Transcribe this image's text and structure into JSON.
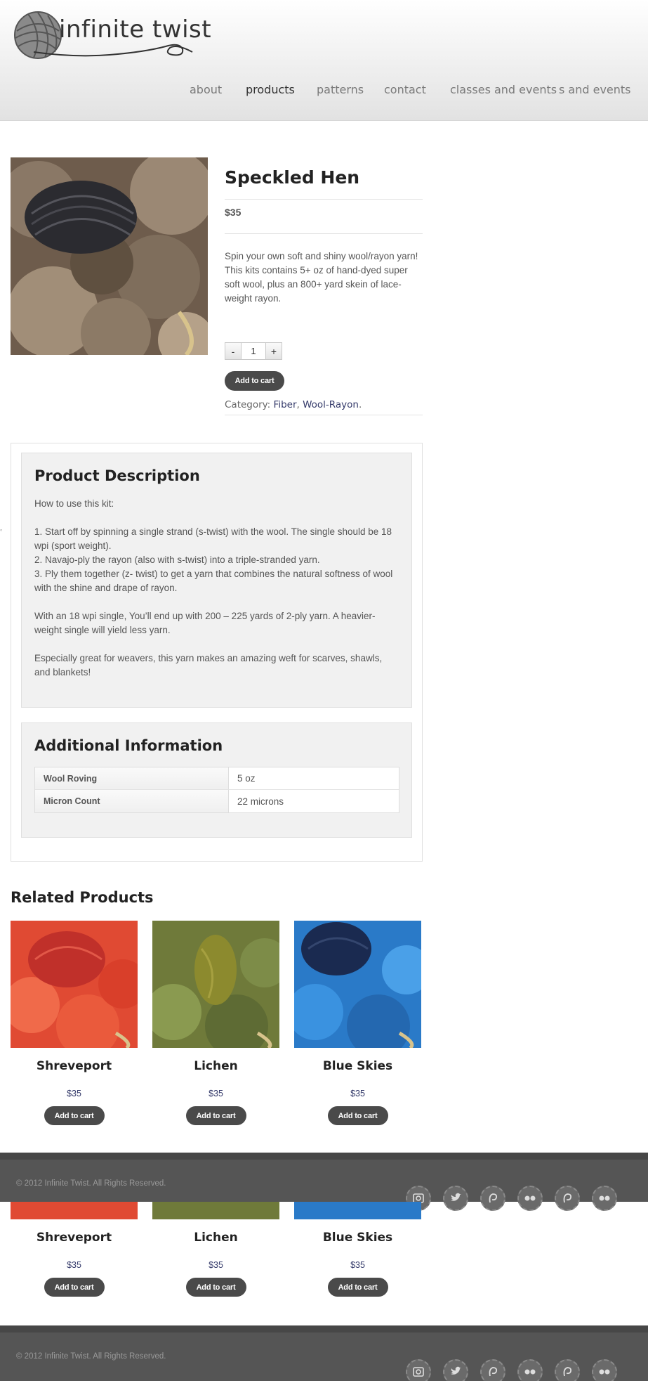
{
  "brand": {
    "logo_text": "infinite twist"
  },
  "nav": {
    "items": [
      {
        "label": "about",
        "active": false
      },
      {
        "label": "products",
        "active": true
      },
      {
        "label": "patterns",
        "active": false
      },
      {
        "label": "contact",
        "active": false
      },
      {
        "label": "classes and events",
        "active": false
      }
    ],
    "overflow_label": "s and events"
  },
  "product": {
    "title": "Speckled Hen",
    "price": "$35",
    "description": "Spin your own soft and shiny wool/rayon yarn! This kits contains 5+ oz of hand-dyed super soft wool, plus an 800+ yard skein of lace-weight rayon.",
    "qty_minus": "-",
    "qty_value": "1",
    "qty_plus": "+",
    "add_to_cart": "Add to cart",
    "category_label": "Category:",
    "categories": [
      "Fiber",
      "Wool-Rayon"
    ],
    "category_sep": ",",
    "category_end": "."
  },
  "tabs": {
    "description": {
      "heading": "Product Description",
      "intro": "How to use this kit:",
      "steps": [
        "1. Start off by spinning a single strand (s-twist) with the wool. The single should be 18 wpi (sport weight).",
        "2. Navajo-ply the rayon (also with s-twist) into a triple-stranded yarn.",
        "3. Ply them together (z- twist) to get a yarn that combines the natural softness of wool with the shine and drape of rayon."
      ],
      "para2": "With an 18 wpi single, You’ll end up with 200 – 225 yards of 2-ply yarn. A heavier-weight single will yield less yarn.",
      "para3": "Especially great for weavers, this yarn makes an amazing weft for scarves, shawls, and blankets!"
    },
    "additional": {
      "heading": "Additional Information",
      "rows": [
        {
          "key": "Wool Roving",
          "value": "5 oz"
        },
        {
          "key": "Micron Count",
          "value": "22 microns"
        }
      ]
    }
  },
  "related": {
    "heading": "Related Products",
    "items": [
      {
        "name": "Shreveport",
        "price": "$35",
        "button": "Add to cart",
        "color": "#e0452e"
      },
      {
        "name": "Lichen",
        "price": "$35",
        "button": "Add to cart",
        "color": "#7d8a3c"
      },
      {
        "name": "Blue Skies",
        "price": "$35",
        "button": "Add to cart",
        "color": "#2f7fc8"
      }
    ]
  },
  "footer": {
    "copyright": "© 2012 Infinite Twist. All Rights Reserved.",
    "social": [
      "instagram-icon",
      "twitter-icon",
      "ravelry-icon",
      "flickr-icon",
      "ravelry-icon",
      "flickr-icon"
    ]
  }
}
